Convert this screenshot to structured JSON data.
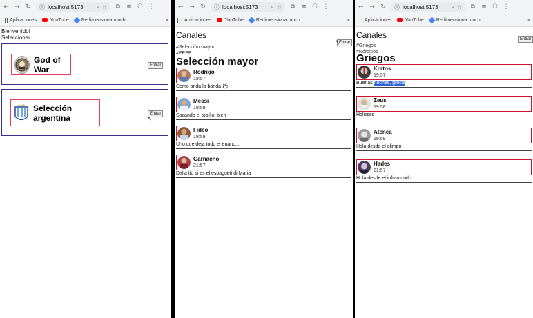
{
  "browser": {
    "url_1": "localhost:5173",
    "url_2": "localhost:5173",
    "url_3": "localhost:5173",
    "bookmarks": [
      "Aplicaciones",
      "YouTube",
      "Redimensiona much..."
    ],
    "more": "»"
  },
  "panel1": {
    "welcome": "Bienvenido!",
    "select": "Seleccionar",
    "cards": [
      {
        "name": "God of War",
        "button": "Entrar"
      },
      {
        "name": "Selección argentina",
        "button": "Entrar"
      }
    ]
  },
  "panel2": {
    "title": "Canales",
    "channels": [
      "#Selección mayor",
      "#PEPE"
    ],
    "button": "Entrar",
    "heading": "Selección mayor",
    "messages": [
      {
        "name": "Rodrigo",
        "time": "19:57",
        "text": "Como anda la banda ⚽"
      },
      {
        "name": "Messi",
        "time": "19:58",
        "text": "Sacando el tobillo, bien"
      },
      {
        "name": "Fideo",
        "time": "19:59",
        "text": "Uno que deja todo el enano..."
      },
      {
        "name": "Garnacho",
        "time": "21:57",
        "text": "Dalla tio si es el espagueti di Maria"
      }
    ]
  },
  "panel3": {
    "title": "Canales",
    "channels": [
      "#Griegos",
      "#Nórdicos"
    ],
    "button": "Entrar",
    "heading": "Griegos",
    "messages": [
      {
        "name": "Kratos",
        "time": "19:57",
        "text_pre": "Buenas ",
        "text_sel": "noches, grecia"
      },
      {
        "name": "Zeus",
        "time": "19:58",
        "text": "Holissss"
      },
      {
        "name": "Atenea",
        "time": "19:59",
        "text": "Hola desde el olimpo"
      },
      {
        "name": "Hades",
        "time": "21:57",
        "text": "Hola desde el inframundo"
      }
    ]
  }
}
